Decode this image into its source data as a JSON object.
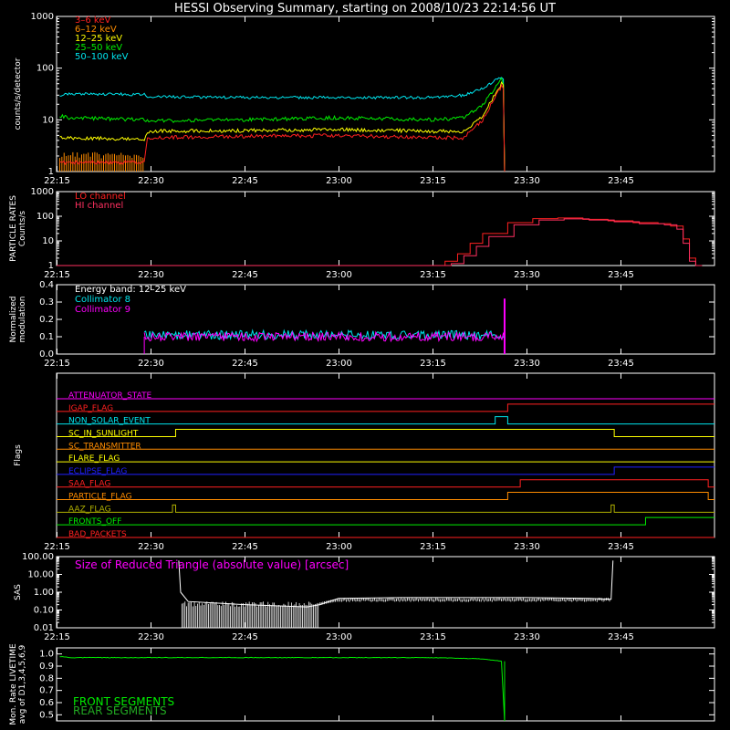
{
  "title": "HESSI Observing Summary, starting on 2008/10/23 22:14:56 UT",
  "time_ticks": [
    "22:15",
    "22:30",
    "22:45",
    "23:00",
    "23:15",
    "23:30",
    "23:45"
  ],
  "colors": {
    "white": "#ffffff",
    "red": "#ff2020",
    "orange": "#ff8c00",
    "yellow": "#ffff00",
    "green": "#00ee00",
    "cyan": "#00e5ee",
    "magenta": "#ff00ff",
    "blue": "#2020ff",
    "pink": "#ff3060",
    "olive": "#b0b000"
  },
  "chart_data": [
    {
      "type": "line",
      "name": "count-rates",
      "ylabel": "counts/s/detector",
      "yscale": "log",
      "ylim": [
        1,
        1000
      ],
      "yticks": [
        "1",
        "10",
        "100",
        "1000"
      ],
      "x_unit": "minutes after 22:14:56",
      "legend": [
        {
          "label": "3–6 keV",
          "color": "red"
        },
        {
          "label": "6–12 keV",
          "color": "orange"
        },
        {
          "label": "12–25 keV",
          "color": "yellow"
        },
        {
          "label": "25–50 keV",
          "color": "green"
        },
        {
          "label": "50–100 keV",
          "color": "cyan"
        }
      ],
      "series": [
        {
          "color": "cyan",
          "x": [
            0.5,
            2,
            14,
            14.5,
            30,
            45,
            60,
            65,
            68,
            71,
            71.3,
            71.5
          ],
          "y": [
            30,
            32,
            31,
            28,
            27,
            27,
            27,
            30,
            40,
            70,
            60,
            1
          ]
        },
        {
          "color": "green",
          "x": [
            0.5,
            2,
            14,
            14.5,
            30,
            45,
            60,
            65,
            68,
            71,
            71.3,
            71.5
          ],
          "y": [
            12,
            11,
            10,
            9.5,
            10,
            11,
            10,
            11,
            20,
            60,
            50,
            1
          ]
        },
        {
          "color": "yellow",
          "x": [
            0.5,
            14,
            14.5,
            30,
            45,
            60,
            65,
            68,
            71,
            71.3,
            71.5
          ],
          "y": [
            4.5,
            4.2,
            6,
            6.2,
            6.5,
            6,
            6,
            12,
            50,
            45,
            1
          ]
        },
        {
          "color": "red",
          "x": [
            0.5,
            14,
            14.5,
            30,
            45,
            60,
            65,
            68,
            71,
            71.3,
            71.5
          ],
          "y": [
            1.5,
            1.5,
            4.5,
            4.8,
            5,
            4.5,
            4.5,
            10,
            45,
            40,
            1
          ]
        },
        {
          "color": "orange",
          "x": [
            0.5,
            14
          ],
          "y": [
            1.8,
            1.8
          ]
        }
      ]
    },
    {
      "type": "line",
      "name": "particle-rates",
      "ylabel": "PARTICLE RATES\nCounts/s",
      "yscale": "log",
      "ylim": [
        1,
        1000
      ],
      "yticks": [
        "1",
        "10",
        "100",
        "1000"
      ],
      "x_unit": "minutes after 22:14:56",
      "legend": [
        {
          "label": "LO channel",
          "color": "red"
        },
        {
          "label": "HI channel",
          "color": "pink"
        }
      ],
      "series": [
        {
          "color": "red",
          "x": [
            0,
            61,
            62,
            64,
            66,
            68,
            72,
            76,
            80,
            84,
            88,
            92,
            96,
            98,
            100,
            101,
            102,
            103
          ],
          "y": [
            1,
            1,
            1.5,
            3,
            8,
            20,
            55,
            80,
            85,
            75,
            65,
            55,
            50,
            40,
            12,
            2,
            1,
            1
          ]
        },
        {
          "color": "pink",
          "x": [
            0,
            62,
            63,
            65,
            67,
            69,
            73,
            77,
            81,
            85,
            89,
            93,
            97,
            99,
            100,
            101,
            102,
            103
          ],
          "y": [
            1,
            1,
            1.2,
            2.5,
            6,
            15,
            45,
            70,
            78,
            70,
            60,
            50,
            45,
            30,
            8,
            1.5,
            1,
            1
          ]
        }
      ]
    },
    {
      "type": "line",
      "name": "modulation",
      "ylabel": "Normalized\nmodulation",
      "ylim": [
        0,
        0.4
      ],
      "yticks": [
        "0.0",
        "0.1",
        "0.2",
        "0.3",
        "0.4"
      ],
      "x_unit": "minutes after 22:14:56",
      "legend_header": "Energy band: 12–25 keV",
      "legend": [
        {
          "label": "Collimator 8",
          "color": "cyan"
        },
        {
          "label": "Collimator 9",
          "color": "magenta"
        }
      ],
      "series": [
        {
          "color": "cyan",
          "x": [
            14,
            71.5
          ],
          "y": [
            0.11,
            0.11
          ]
        },
        {
          "color": "magenta",
          "x": [
            14,
            71.5
          ],
          "y": [
            0.1,
            0.1
          ]
        }
      ]
    },
    {
      "type": "line",
      "name": "flags",
      "ylabel": "Flags",
      "x_unit": "minutes after 22:14:56",
      "flags": [
        {
          "label": "ATTENUATOR_STATE",
          "color": "magenta",
          "steps": []
        },
        {
          "label": "IGAP_FLAG",
          "color": "red",
          "steps": [
            [
              72,
              1
            ]
          ]
        },
        {
          "label": "NON_SOLAR_EVENT",
          "color": "cyan",
          "steps": [
            [
              70,
              1
            ],
            [
              72,
              0
            ]
          ]
        },
        {
          "label": "SC_IN_SUNLIGHT",
          "color": "yellow",
          "steps": [
            [
              19,
              1
            ],
            [
              89,
              0
            ]
          ]
        },
        {
          "label": "SC_TRANSMITTER",
          "color": "orange",
          "steps": []
        },
        {
          "label": "FLARE_FLAG",
          "color": "yellow",
          "steps": []
        },
        {
          "label": "ECLIPSE_FLAG",
          "color": "blue",
          "steps": [
            [
              19,
              0
            ],
            [
              89,
              1
            ]
          ]
        },
        {
          "label": "SAA_FLAG",
          "color": "red",
          "steps": [
            [
              74,
              1
            ],
            [
              104,
              0
            ]
          ]
        },
        {
          "label": "PARTICLE_FLAG",
          "color": "orange",
          "steps": [
            [
              72,
              1
            ],
            [
              104,
              0
            ]
          ]
        },
        {
          "label": "AAZ_FLAG",
          "color": "olive",
          "steps": [
            [
              18.5,
              1
            ],
            [
              19,
              0
            ],
            [
              88.5,
              1
            ],
            [
              89,
              0
            ]
          ]
        },
        {
          "label": "FRONTS_OFF",
          "color": "green",
          "steps": [
            [
              14,
              0
            ],
            [
              94,
              1
            ]
          ]
        },
        {
          "label": "BAD_PACKETS",
          "color": "red",
          "steps": []
        }
      ]
    },
    {
      "type": "line",
      "name": "sas",
      "ylabel": "SAS",
      "annotation": "Size of Reduced Triangle (absolute value) [arcsec]",
      "yscale": "log",
      "ylim": [
        0.01,
        100
      ],
      "yticks": [
        "0.01",
        "0.10",
        "1.00",
        "10.00",
        "100.00"
      ],
      "x_unit": "minutes after 22:14:56",
      "series": [
        {
          "color": "white",
          "x": [
            19.5,
            19.8,
            21,
            30,
            40,
            42,
            45,
            55,
            65,
            75,
            85,
            88.5,
            88.8
          ],
          "y": [
            60,
            1,
            0.3,
            0.2,
            0.15,
            0.2,
            0.45,
            0.5,
            0.5,
            0.5,
            0.45,
            0.4,
            60
          ]
        }
      ]
    },
    {
      "type": "line",
      "name": "livetime",
      "ylabel": "Mon. Rate LIVETIME\navg of D1,3,4,5,6,9",
      "ylim": [
        0.45,
        1.05
      ],
      "yticks": [
        "0.5",
        "0.6",
        "0.7",
        "0.8",
        "0.9",
        "1.0"
      ],
      "x_unit": "minutes after 22:14:56",
      "legend": [
        {
          "label": "FRONT SEGMENTS",
          "color": "green"
        },
        {
          "label": "REAR SEGMENTS",
          "color": "green"
        }
      ],
      "series": [
        {
          "color": "green",
          "x": [
            0.5,
            2,
            20,
            40,
            60,
            68,
            71,
            71.5
          ],
          "y": [
            0.98,
            0.97,
            0.97,
            0.97,
            0.97,
            0.96,
            0.94,
            0.45
          ]
        }
      ]
    }
  ]
}
